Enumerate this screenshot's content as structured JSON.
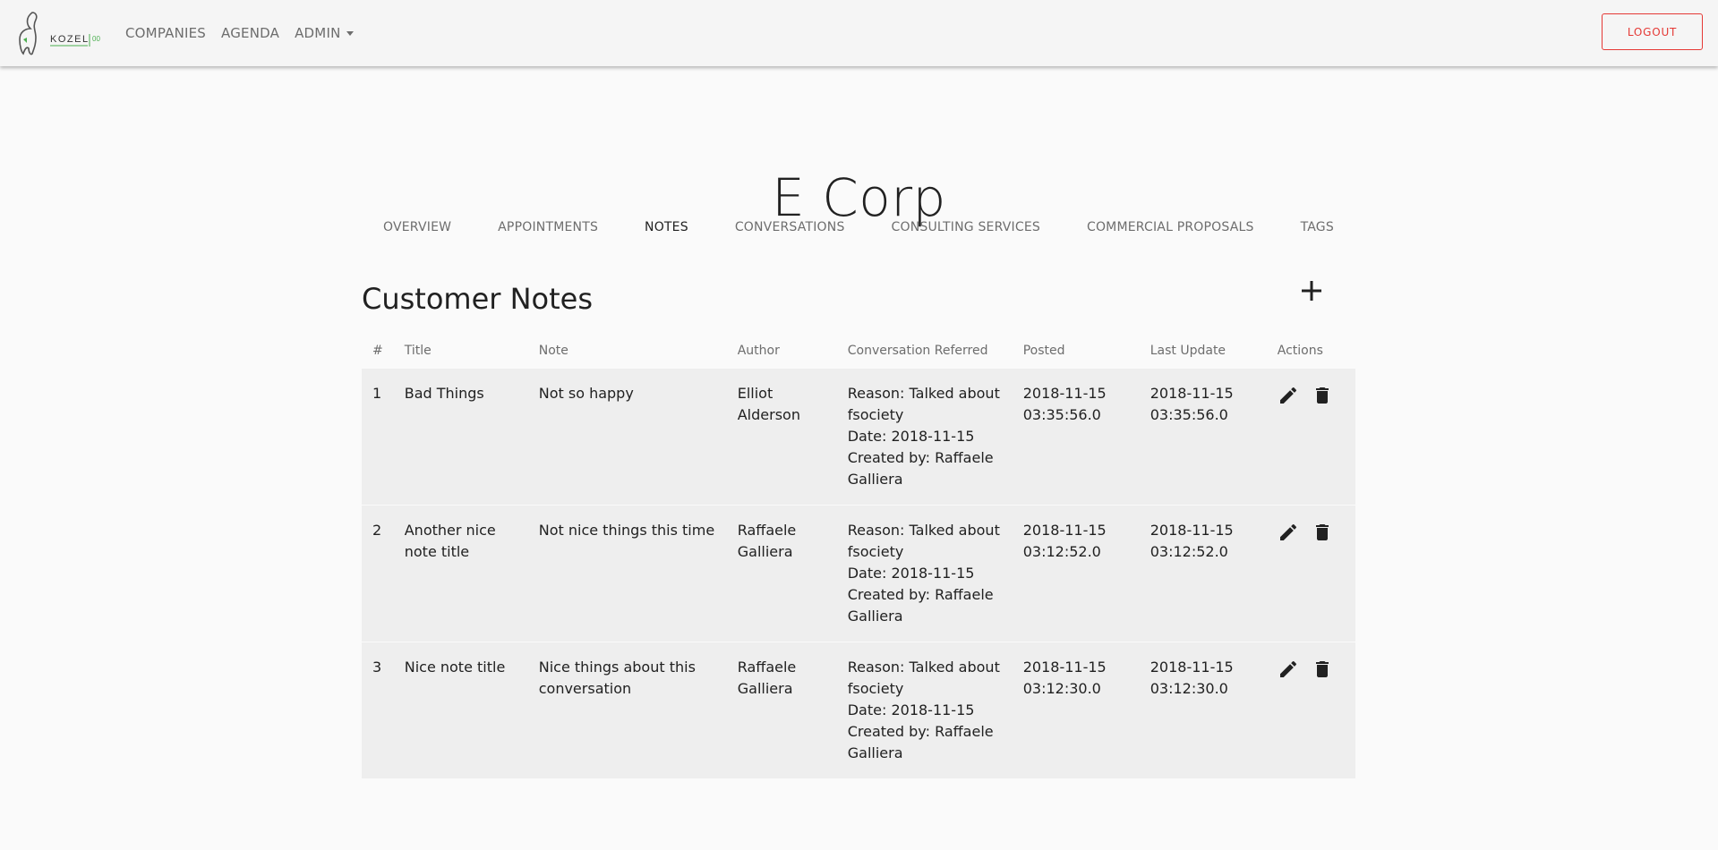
{
  "brand": {
    "logo_text": "KOZEL",
    "logo_suffix": "00"
  },
  "nav": {
    "items": [
      "COMPANIES",
      "AGENDA",
      "ADMIN"
    ],
    "logout_label": "LOGOUT"
  },
  "company": {
    "name": "E Corp"
  },
  "tabs": [
    {
      "label": "OVERVIEW",
      "active": false
    },
    {
      "label": "APPOINTMENTS",
      "active": false
    },
    {
      "label": "NOTES",
      "active": true
    },
    {
      "label": "CONVERSATIONS",
      "active": false
    },
    {
      "label": "CONSULTING SERVICES",
      "active": false
    },
    {
      "label": "COMMERCIAL PROPOSALS",
      "active": false
    },
    {
      "label": "TAGS",
      "active": false
    }
  ],
  "section": {
    "title": "Customer Notes"
  },
  "table": {
    "headers": [
      "#",
      "Title",
      "Note",
      "Author",
      "Conversation Referred",
      "Posted",
      "Last Update",
      "Actions"
    ],
    "rows": [
      {
        "num": "1",
        "title": "Bad Things",
        "note": "Not so happy",
        "author": "Elliot Alderson",
        "conv_reason": "Reason: Talked about fsociety",
        "conv_date": "Date: 2018-11-15",
        "conv_created": "Created by: Raffaele Galliera",
        "posted_date": "2018-11-15",
        "posted_time": "03:35:56.0",
        "updated_date": "2018-11-15",
        "updated_time": "03:35:56.0"
      },
      {
        "num": "2",
        "title": "Another nice note title",
        "note": "Not nice things this time",
        "author": "Raffaele Galliera",
        "conv_reason": "Reason: Talked about fsociety",
        "conv_date": "Date: 2018-11-15",
        "conv_created": "Created by: Raffaele Galliera",
        "posted_date": "2018-11-15",
        "posted_time": "03:12:52.0",
        "updated_date": "2018-11-15",
        "updated_time": "03:12:52.0"
      },
      {
        "num": "3",
        "title": "Nice note title",
        "note": "Nice things about this conversation",
        "author": "Raffaele Galliera",
        "conv_reason": "Reason: Talked about fsociety",
        "conv_date": "Date: 2018-11-15",
        "conv_created": "Created by: Raffaele Galliera",
        "posted_date": "2018-11-15",
        "posted_time": "03:12:30.0",
        "updated_date": "2018-11-15",
        "updated_time": "03:12:30.0"
      }
    ]
  },
  "colors": {
    "accent": "#e53935",
    "logo_green": "#4caf50",
    "row_bg": "#eeeeee"
  },
  "icons": {
    "edit": "pencil-icon",
    "delete": "trash-icon",
    "add": "plus-icon"
  }
}
